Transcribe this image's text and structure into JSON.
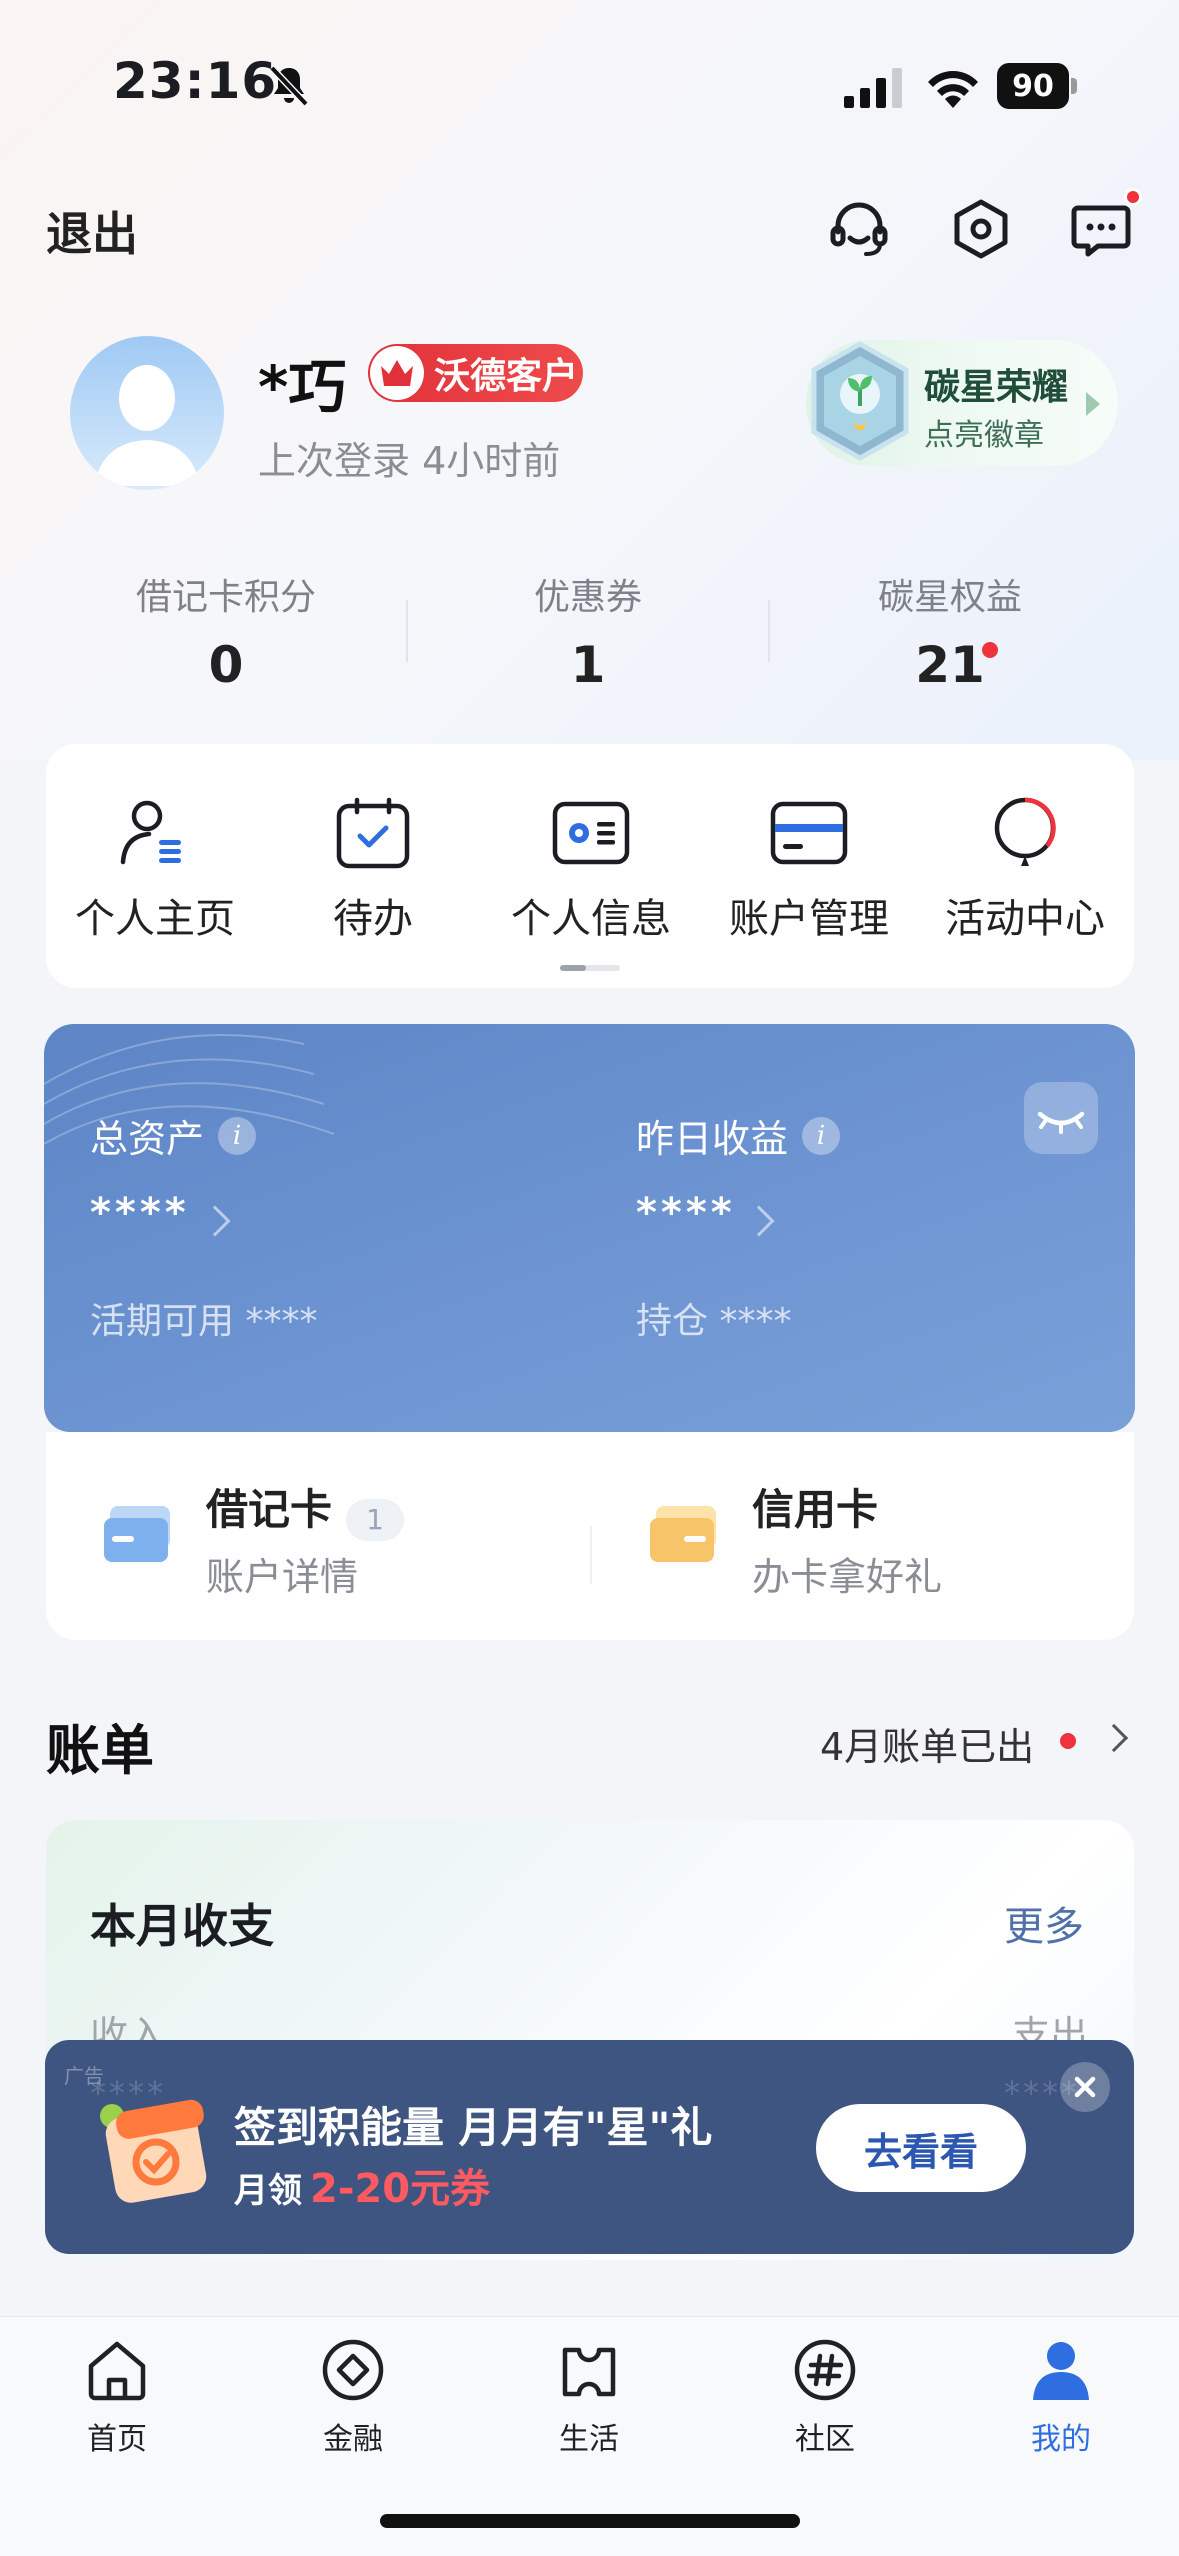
{
  "status_bar": {
    "time": "23:16",
    "battery": "90"
  },
  "header": {
    "logout_label": "退出"
  },
  "profile": {
    "name": "*巧",
    "vip_badge": "沃德客户",
    "last_login": "上次登录 4小时前",
    "carbon_title": "碳星荣耀",
    "carbon_sub": "点亮徽章"
  },
  "stats": [
    {
      "label": "借记卡积分",
      "value": "0"
    },
    {
      "label": "优惠券",
      "value": "1"
    },
    {
      "label": "碳星权益",
      "value": "21"
    }
  ],
  "quick_menu": [
    {
      "label": "个人主页",
      "icon": "person-list-icon"
    },
    {
      "label": "待办",
      "icon": "calendar-check-icon"
    },
    {
      "label": "个人信息",
      "icon": "id-card-icon"
    },
    {
      "label": "账户管理",
      "icon": "bank-card-icon"
    },
    {
      "label": "活动中心",
      "icon": "balloon-icon"
    }
  ],
  "assets": {
    "total_label": "总资产",
    "total_value": "****",
    "available": "活期可用 ****",
    "yesterday_label": "昨日收益",
    "yesterday_value": "****",
    "holdings": "持仓 ****"
  },
  "cards": {
    "debit_title": "借记卡",
    "debit_count": "1",
    "debit_sub": "账户详情",
    "credit_title": "信用卡",
    "credit_sub": "办卡拿好礼"
  },
  "bill": {
    "title": "账单",
    "status": "4月账单已出",
    "month_title": "本月收支",
    "more": "更多",
    "income": "收入",
    "expense": "支出",
    "income_value": "****",
    "expense_value": "****"
  },
  "ad": {
    "tag": "广告",
    "title": "签到积能量 月月有\"星\"礼",
    "sub_prefix": "月领",
    "sub_highlight": "2-20元券",
    "button": "去看看"
  },
  "tabbar": [
    {
      "label": "首页",
      "icon": "home-icon"
    },
    {
      "label": "金融",
      "icon": "finance-diamond-icon"
    },
    {
      "label": "生活",
      "icon": "ticket-icon"
    },
    {
      "label": "社区",
      "icon": "hashtag-icon"
    },
    {
      "label": "我的",
      "icon": "person-icon"
    }
  ],
  "colors": {
    "accent": "#2f6ee0",
    "asset_card": "#6a90ce",
    "ad_banner": "#3e5581",
    "red": "#f0323c"
  }
}
